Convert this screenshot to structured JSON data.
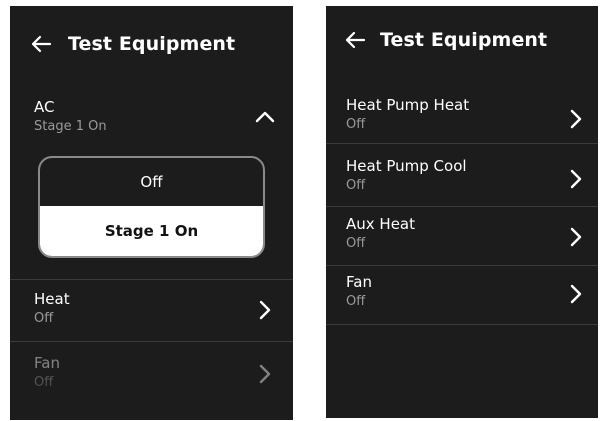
{
  "left": {
    "title": "Test Equipment",
    "ac": {
      "label": "AC",
      "status": "Stage 1 On"
    },
    "dropdown": {
      "options": [
        "Off",
        "Stage 1 On"
      ],
      "selected": "Stage 1 On"
    },
    "items": [
      {
        "label": "Heat",
        "status": "Off"
      },
      {
        "label": "Fan",
        "status": "Off"
      }
    ]
  },
  "right": {
    "title": "Test Equipment",
    "items": [
      {
        "label": "Heat Pump Heat",
        "status": "Off"
      },
      {
        "label": "Heat Pump Cool",
        "status": "Off"
      },
      {
        "label": "Aux Heat",
        "status": "Off"
      },
      {
        "label": "Fan",
        "status": "Off"
      }
    ]
  },
  "icons": [
    "back-arrow-icon",
    "chevron-up-icon",
    "chevron-right-icon"
  ],
  "colors": {
    "background": "#1c1c1c",
    "text": "#ffffff",
    "subtext": "#9a9a9a",
    "divider": "#3b3b3b",
    "selected_option_bg": "#ffffff"
  }
}
